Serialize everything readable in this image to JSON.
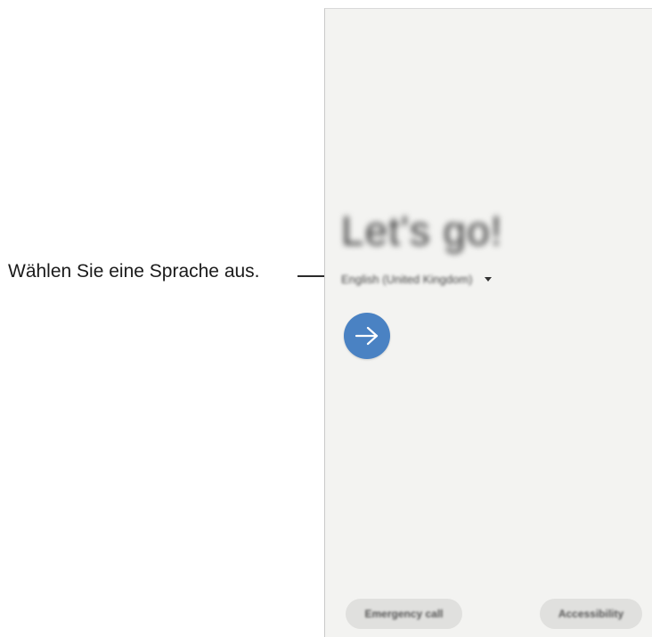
{
  "callout": {
    "text": "Wählen Sie eine Sprache aus."
  },
  "screen": {
    "welcome_title": "Let's go!",
    "language": {
      "selected": "English (United Kingdom)",
      "icon": "chevron-down-icon"
    },
    "next_button": {
      "icon": "arrow-right-icon",
      "color": "#4a82c3"
    },
    "bottom_buttons": {
      "emergency_call": "Emergency call",
      "accessibility": "Accessibility"
    },
    "background_color": "#f3f3f1"
  }
}
